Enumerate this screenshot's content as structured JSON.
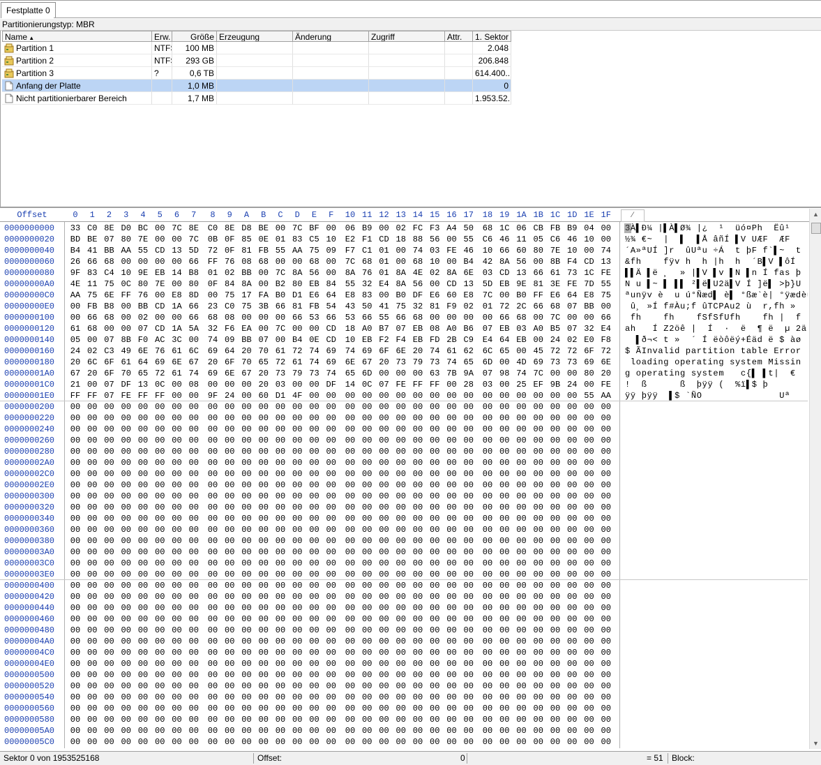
{
  "tabs": [
    {
      "label": "Festplatte 0"
    }
  ],
  "partition_type": "Partitionierungstyp: MBR",
  "columns": [
    "Name",
    "Erw.",
    "Größe",
    "Erzeugung",
    "Änderung",
    "Zugriff",
    "Attr.",
    "1. Sektor"
  ],
  "sort_indicator": "▲",
  "partitions": [
    {
      "name": "Partition 1",
      "ext": "NTFS",
      "size": "100 MB",
      "created": "",
      "modified": "",
      "accessed": "",
      "attr": "",
      "sector": "2.048",
      "icon": "partition-icon",
      "selected": false
    },
    {
      "name": "Partition 2",
      "ext": "NTFS",
      "size": "293 GB",
      "created": "",
      "modified": "",
      "accessed": "",
      "attr": "",
      "sector": "206.848",
      "icon": "partition-icon",
      "selected": false
    },
    {
      "name": "Partition 3",
      "ext": "?",
      "size": "0,6 TB",
      "created": "",
      "modified": "",
      "accessed": "",
      "attr": "",
      "sector": "614.400....",
      "icon": "partition-icon",
      "selected": false
    },
    {
      "name": "Anfang der Platte",
      "ext": "",
      "size": "1,0 MB",
      "created": "",
      "modified": "",
      "accessed": "",
      "attr": "",
      "sector": "0",
      "icon": "file-icon",
      "selected": true
    },
    {
      "name": "Nicht partitionierbarer Bereich",
      "ext": "",
      "size": "1,7 MB",
      "created": "",
      "modified": "",
      "accessed": "",
      "attr": "",
      "sector": "1.953.52...",
      "icon": "file-icon",
      "selected": false
    }
  ],
  "hex": {
    "offset_label": "Offset",
    "column_headers": [
      "0",
      "1",
      "2",
      "3",
      "4",
      "5",
      "6",
      "7",
      "8",
      "9",
      "A",
      "B",
      "C",
      "D",
      "E",
      "F",
      "10",
      "11",
      "12",
      "13",
      "14",
      "15",
      "16",
      "17",
      "18",
      "19",
      "1A",
      "1B",
      "1C",
      "1D",
      "1E",
      "1F"
    ],
    "edit_mode_symbol": "⁄",
    "rows": [
      {
        "offset": "0000000000",
        "bytes": "33 C0 8E D0 BC 00 7C 8E C0 8E D8 BE 00 7C BF 00 06 B9 00 02 FC F3 A4 50 68 1C 06 CB FB B9 04 00",
        "ascii": "3À▌Ð¼ |▌À▌Ø¾ |¿  ¹  üó¤Ph  Ëû¹"
      },
      {
        "offset": "0000000020",
        "bytes": "BD BE 07 80 7E 00 00 7C 0B 0F 85 0E 01 83 C5 10 E2 F1 CD 18 88 56 00 55 C6 46 11 05 C6 46 10 00",
        "ascii": "½¾ €~  |  ▌  ▌Å âñÍ ▌V UÆF  ÆF"
      },
      {
        "offset": "0000000040",
        "bytes": "B4 41 BB AA 55 CD 13 5D 72 0F 81 FB 55 AA 75 09 F7 C1 01 00 74 03 FE 46 10 66 60 80 7E 10 00 74",
        "ascii": "´A»ªUÍ ]r  ûUªu ÷Á  t þF f`▌~  t"
      },
      {
        "offset": "0000000060",
        "bytes": "26 66 68 00 00 00 00 66 FF 76 08 68 00 00 68 00 7C 68 01 00 68 10 00 B4 42 8A 56 00 8B F4 CD 13",
        "ascii": "&fh    fÿv h  h |h  h  ´B▌V ▌ôÍ"
      },
      {
        "offset": "0000000080",
        "bytes": "9F 83 C4 10 9E EB 14 B8 01 02 BB 00 7C 8A 56 00 8A 76 01 8A 4E 02 8A 6E 03 CD 13 66 61 73 1C FE",
        "ascii": "▌▌Ä ▌ë ¸  » |▌V ▌v ▌N ▌n Í fas þ"
      },
      {
        "offset": "00000000A0",
        "bytes": "4E 11 75 0C 80 7E 00 80 0F 84 8A 00 B2 80 EB 84 55 32 E4 8A 56 00 CD 13 5D EB 9E 81 3E FE 7D 55",
        "ascii": "N u ▌~ ▌ ▌▌ ²▌ë▌U2ä▌V Í ]ë▌ >þ}U"
      },
      {
        "offset": "00000000C0",
        "bytes": "AA 75 6E FF 76 00 E8 8D 00 75 17 FA B0 D1 E6 64 E8 83 00 B0 DF E6 60 E8 7C 00 B0 FF E6 64 E8 75",
        "ascii": "ªunÿv è  u ú°Ñæd▌ è▌ °ßæ`è| °ÿædèu"
      },
      {
        "offset": "00000000E0",
        "bytes": "00 FB B8 00 BB CD 1A 66 23 C0 75 3B 66 81 FB 54 43 50 41 75 32 81 F9 02 01 72 2C 66 68 07 BB 00",
        "ascii": " û¸ »Í f#Àu;f ûTCPAu2 ù  r,fh »"
      },
      {
        "offset": "0000000100",
        "bytes": "00 66 68 00 02 00 00 66 68 08 00 00 00 66 53 66 53 66 55 66 68 00 00 00 00 66 68 00 7C 00 00 66",
        "ascii": " fh    fh    fSfSfUfh    fh |  f"
      },
      {
        "offset": "0000000120",
        "bytes": "61 68 00 00 07 CD 1A 5A 32 F6 EA 00 7C 00 00 CD 18 A0 B7 07 EB 08 A0 B6 07 EB 03 A0 B5 07 32 E4",
        "ascii": "ah   Í Z2öê |  Í  ·  ë  ¶ ë  µ 2ä"
      },
      {
        "offset": "0000000140",
        "bytes": "05 00 07 8B F0 AC 3C 00 74 09 BB 07 00 B4 0E CD 10 EB F2 F4 EB FD 2B C9 E4 64 EB 00 24 02 E0 F8",
        "ascii": "  ▌ð¬< t »  ´ Í ëòôëý+Éäd ë $ àø"
      },
      {
        "offset": "0000000160",
        "bytes": "24 02 C3 49 6E 76 61 6C 69 64 20 70 61 72 74 69 74 69 6F 6E 20 74 61 62 6C 65 00 45 72 72 6F 72",
        "ascii": "$ ÃInvalid partition table Error"
      },
      {
        "offset": "0000000180",
        "bytes": "20 6C 6F 61 64 69 6E 67 20 6F 70 65 72 61 74 69 6E 67 20 73 79 73 74 65 6D 00 4D 69 73 73 69 6E",
        "ascii": " loading operating system Missin"
      },
      {
        "offset": "00000001A0",
        "bytes": "67 20 6F 70 65 72 61 74 69 6E 67 20 73 79 73 74 65 6D 00 00 00 63 7B 9A 07 98 74 7C 00 00 80 20",
        "ascii": "g operating system   c{▌ ▌t|  €"
      },
      {
        "offset": "00000001C0",
        "bytes": "21 00 07 DF 13 0C 00 08 00 00 00 20 03 00 00 DF 14 0C 07 FE FF FF 00 28 03 00 25 EF 9B 24 00 FE",
        "ascii": "!  ß      ß  þÿÿ (  %ï▌$ þ"
      },
      {
        "offset": "00000001E0",
        "bytes": "FF FF 07 FE FF FF 00 00 9F 24 00 60 D1 4F 00 00 00 00 00 00 00 00 00 00 00 00 00 00 00 00 55 AA",
        "ascii": "ÿÿ þÿÿ  ▌$ `ÑO              Uª"
      },
      {
        "offset": "0000000200",
        "bytes": "00 00 00 00 00 00 00 00 00 00 00 00 00 00 00 00 00 00 00 00 00 00 00 00 00 00 00 00 00 00 00 00",
        "ascii": ""
      },
      {
        "offset": "0000000220",
        "bytes": "00 00 00 00 00 00 00 00 00 00 00 00 00 00 00 00 00 00 00 00 00 00 00 00 00 00 00 00 00 00 00 00",
        "ascii": ""
      },
      {
        "offset": "0000000240",
        "bytes": "00 00 00 00 00 00 00 00 00 00 00 00 00 00 00 00 00 00 00 00 00 00 00 00 00 00 00 00 00 00 00 00",
        "ascii": ""
      },
      {
        "offset": "0000000260",
        "bytes": "00 00 00 00 00 00 00 00 00 00 00 00 00 00 00 00 00 00 00 00 00 00 00 00 00 00 00 00 00 00 00 00",
        "ascii": ""
      },
      {
        "offset": "0000000280",
        "bytes": "00 00 00 00 00 00 00 00 00 00 00 00 00 00 00 00 00 00 00 00 00 00 00 00 00 00 00 00 00 00 00 00",
        "ascii": ""
      },
      {
        "offset": "00000002A0",
        "bytes": "00 00 00 00 00 00 00 00 00 00 00 00 00 00 00 00 00 00 00 00 00 00 00 00 00 00 00 00 00 00 00 00",
        "ascii": ""
      },
      {
        "offset": "00000002C0",
        "bytes": "00 00 00 00 00 00 00 00 00 00 00 00 00 00 00 00 00 00 00 00 00 00 00 00 00 00 00 00 00 00 00 00",
        "ascii": ""
      },
      {
        "offset": "00000002E0",
        "bytes": "00 00 00 00 00 00 00 00 00 00 00 00 00 00 00 00 00 00 00 00 00 00 00 00 00 00 00 00 00 00 00 00",
        "ascii": ""
      },
      {
        "offset": "0000000300",
        "bytes": "00 00 00 00 00 00 00 00 00 00 00 00 00 00 00 00 00 00 00 00 00 00 00 00 00 00 00 00 00 00 00 00",
        "ascii": ""
      },
      {
        "offset": "0000000320",
        "bytes": "00 00 00 00 00 00 00 00 00 00 00 00 00 00 00 00 00 00 00 00 00 00 00 00 00 00 00 00 00 00 00 00",
        "ascii": ""
      },
      {
        "offset": "0000000340",
        "bytes": "00 00 00 00 00 00 00 00 00 00 00 00 00 00 00 00 00 00 00 00 00 00 00 00 00 00 00 00 00 00 00 00",
        "ascii": ""
      },
      {
        "offset": "0000000360",
        "bytes": "00 00 00 00 00 00 00 00 00 00 00 00 00 00 00 00 00 00 00 00 00 00 00 00 00 00 00 00 00 00 00 00",
        "ascii": ""
      },
      {
        "offset": "0000000380",
        "bytes": "00 00 00 00 00 00 00 00 00 00 00 00 00 00 00 00 00 00 00 00 00 00 00 00 00 00 00 00 00 00 00 00",
        "ascii": ""
      },
      {
        "offset": "00000003A0",
        "bytes": "00 00 00 00 00 00 00 00 00 00 00 00 00 00 00 00 00 00 00 00 00 00 00 00 00 00 00 00 00 00 00 00",
        "ascii": ""
      },
      {
        "offset": "00000003C0",
        "bytes": "00 00 00 00 00 00 00 00 00 00 00 00 00 00 00 00 00 00 00 00 00 00 00 00 00 00 00 00 00 00 00 00",
        "ascii": ""
      },
      {
        "offset": "00000003E0",
        "bytes": "00 00 00 00 00 00 00 00 00 00 00 00 00 00 00 00 00 00 00 00 00 00 00 00 00 00 00 00 00 00 00 00",
        "ascii": ""
      },
      {
        "offset": "0000000400",
        "bytes": "00 00 00 00 00 00 00 00 00 00 00 00 00 00 00 00 00 00 00 00 00 00 00 00 00 00 00 00 00 00 00 00",
        "ascii": ""
      },
      {
        "offset": "0000000420",
        "bytes": "00 00 00 00 00 00 00 00 00 00 00 00 00 00 00 00 00 00 00 00 00 00 00 00 00 00 00 00 00 00 00 00",
        "ascii": ""
      },
      {
        "offset": "0000000440",
        "bytes": "00 00 00 00 00 00 00 00 00 00 00 00 00 00 00 00 00 00 00 00 00 00 00 00 00 00 00 00 00 00 00 00",
        "ascii": ""
      },
      {
        "offset": "0000000460",
        "bytes": "00 00 00 00 00 00 00 00 00 00 00 00 00 00 00 00 00 00 00 00 00 00 00 00 00 00 00 00 00 00 00 00",
        "ascii": ""
      },
      {
        "offset": "0000000480",
        "bytes": "00 00 00 00 00 00 00 00 00 00 00 00 00 00 00 00 00 00 00 00 00 00 00 00 00 00 00 00 00 00 00 00",
        "ascii": ""
      },
      {
        "offset": "00000004A0",
        "bytes": "00 00 00 00 00 00 00 00 00 00 00 00 00 00 00 00 00 00 00 00 00 00 00 00 00 00 00 00 00 00 00 00",
        "ascii": ""
      },
      {
        "offset": "00000004C0",
        "bytes": "00 00 00 00 00 00 00 00 00 00 00 00 00 00 00 00 00 00 00 00 00 00 00 00 00 00 00 00 00 00 00 00",
        "ascii": ""
      },
      {
        "offset": "00000004E0",
        "bytes": "00 00 00 00 00 00 00 00 00 00 00 00 00 00 00 00 00 00 00 00 00 00 00 00 00 00 00 00 00 00 00 00",
        "ascii": ""
      },
      {
        "offset": "0000000500",
        "bytes": "00 00 00 00 00 00 00 00 00 00 00 00 00 00 00 00 00 00 00 00 00 00 00 00 00 00 00 00 00 00 00 00",
        "ascii": ""
      },
      {
        "offset": "0000000520",
        "bytes": "00 00 00 00 00 00 00 00 00 00 00 00 00 00 00 00 00 00 00 00 00 00 00 00 00 00 00 00 00 00 00 00",
        "ascii": ""
      },
      {
        "offset": "0000000540",
        "bytes": "00 00 00 00 00 00 00 00 00 00 00 00 00 00 00 00 00 00 00 00 00 00 00 00 00 00 00 00 00 00 00 00",
        "ascii": ""
      },
      {
        "offset": "0000000560",
        "bytes": "00 00 00 00 00 00 00 00 00 00 00 00 00 00 00 00 00 00 00 00 00 00 00 00 00 00 00 00 00 00 00 00",
        "ascii": ""
      },
      {
        "offset": "0000000580",
        "bytes": "00 00 00 00 00 00 00 00 00 00 00 00 00 00 00 00 00 00 00 00 00 00 00 00 00 00 00 00 00 00 00 00",
        "ascii": ""
      },
      {
        "offset": "00000005A0",
        "bytes": "00 00 00 00 00 00 00 00 00 00 00 00 00 00 00 00 00 00 00 00 00 00 00 00 00 00 00 00 00 00 00 00",
        "ascii": ""
      },
      {
        "offset": "00000005C0",
        "bytes": "00 00 00 00 00 00 00 00 00 00 00 00 00 00 00 00 00 00 00 00 00 00 00 00 00 00 00 00 00 00 00 00",
        "ascii": ""
      }
    ]
  },
  "status": {
    "sector": "Sektor 0 von 1953525168",
    "offset_label": "Offset:",
    "offset_value": "0",
    "value": "= 51",
    "block_label": "Block:"
  },
  "colors": {
    "accent": "#1a3fb0",
    "selection": "#bcd5f5"
  }
}
